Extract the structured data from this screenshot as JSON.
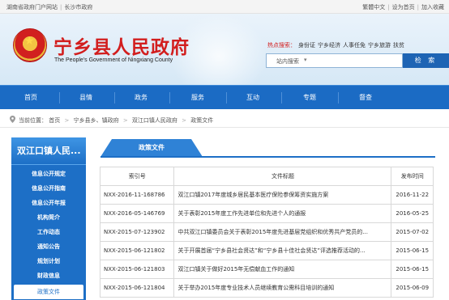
{
  "topbar": {
    "left_links": [
      "湖南省政府门户网站",
      "长沙市政府"
    ],
    "right_links": [
      "繁體中文",
      "设为首页",
      "加入收藏"
    ]
  },
  "header": {
    "title": "宁乡县人民政府",
    "subtitle": "The People's Government of Ningxiang County",
    "hot_label": "热点搜索：",
    "hot_items": [
      "身份证",
      "宁乡经济",
      "人事任免",
      "宁乡旅游",
      "扶贫"
    ],
    "search_scope": "站内搜索",
    "search_button": "检 索",
    "colors": {
      "title_red": "#d21e1e",
      "nav_blue": "#1b6bc4"
    }
  },
  "nav": {
    "items": [
      "首页",
      "县情",
      "政务",
      "服务",
      "互动",
      "专题",
      "督查"
    ]
  },
  "breadcrumb": {
    "prefix": "当前位置：",
    "path": [
      "首页",
      "宁乡县乡、镇政府",
      "双江口镇人民政府",
      "政策文件"
    ],
    "separator": ">"
  },
  "sidebar": {
    "title": "双江口镇人民...",
    "items": [
      "信息公开规定",
      "信息公开指南",
      "信息公开年报",
      "机构简介",
      "工作动态",
      "通知公告",
      "规划计划",
      "财政信息",
      "政策文件"
    ],
    "active_index": 8
  },
  "content": {
    "tab_label": "政策文件",
    "columns": [
      "索引号",
      "文件标题",
      "发布时间"
    ],
    "rows": [
      {
        "index": "NXX-2016-11-168786",
        "title": "双江口镇2017年度城乡居民基本医疗保险参保筹资实施方案",
        "date": "2016-11-22"
      },
      {
        "index": "NXX-2016-05-146769",
        "title": "关于表彰2015年度工作先进单位和先进个人的通报",
        "date": "2016-05-25"
      },
      {
        "index": "NXX-2015-07-123902",
        "title": "中共双江口镇委员会关于表彰2015年度先进基层党组织和优秀共产党员的...",
        "date": "2015-07-02"
      },
      {
        "index": "NXX-2015-06-121802",
        "title": "关于开展首届“宁乡县社会贤达”和“宁乡县十佳社会贤达”评选推荐活动的...",
        "date": "2015-06-15"
      },
      {
        "index": "NXX-2015-06-121803",
        "title": "双江口镇关于做好2015年无偿献血工作的通知",
        "date": "2015-06-15"
      },
      {
        "index": "NXX-2015-06-121804",
        "title": "关于举办2015年度专业技术人员继续教育公需科目培训的通知",
        "date": "2015-06-09"
      }
    ]
  }
}
